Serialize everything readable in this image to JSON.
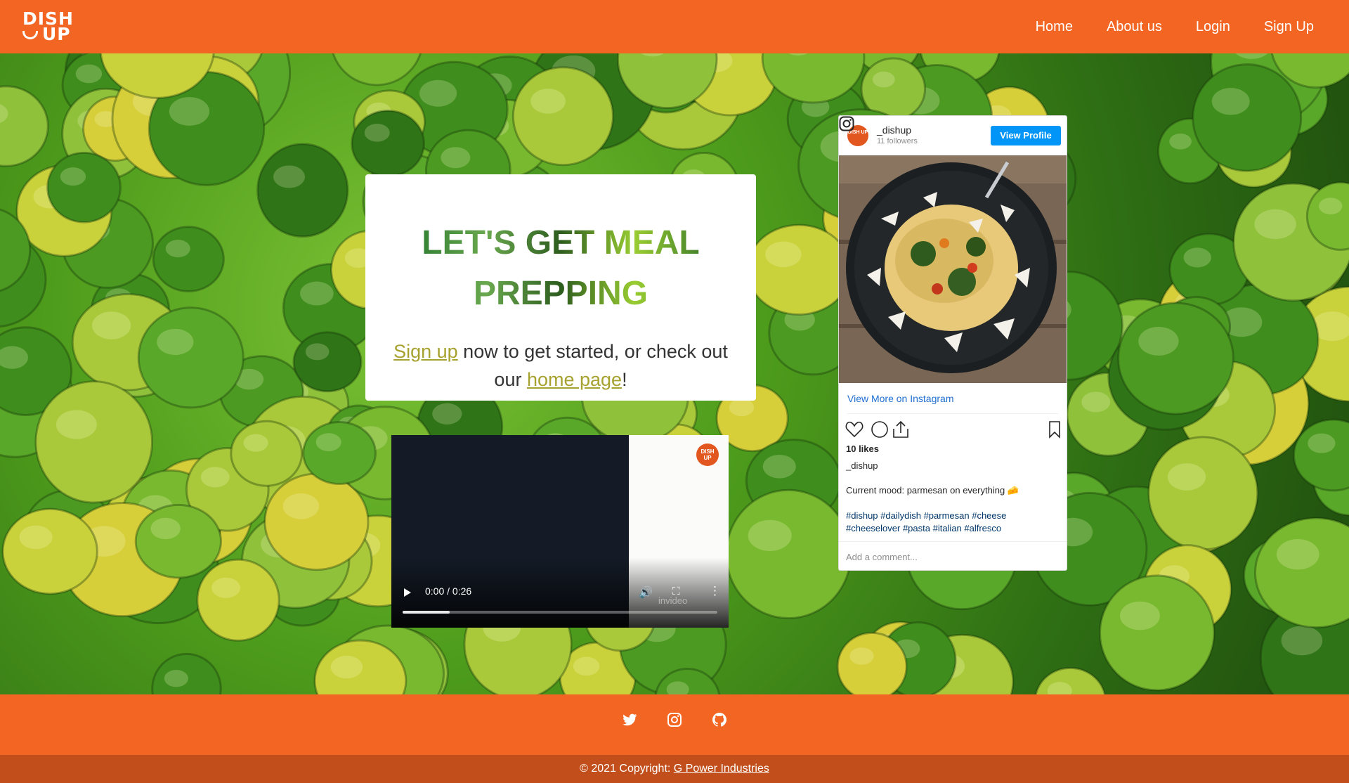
{
  "brand": {
    "logo_line1": "DISH",
    "logo_line2": "UP",
    "color": "#f26522"
  },
  "nav": {
    "links": [
      "Home",
      "About us",
      "Login",
      "Sign Up"
    ]
  },
  "hero": {
    "title": "LET'S GET MEAL PREPPING",
    "signup_link": "Sign up",
    "text_middle": " now to get started, or check out our ",
    "home_link": "home page",
    "text_end": "!"
  },
  "video": {
    "time": "0:00 / 0:26",
    "badge_text": "DISH UP",
    "watermark": "invideo",
    "progress": 0.15,
    "icons": [
      "play-icon",
      "volume-icon",
      "fullscreen-icon",
      "more-options-icon"
    ]
  },
  "instagram": {
    "avatar_text": "DISH UP",
    "username": "_dishup",
    "followers": "11 followers",
    "view_profile": "View Profile",
    "view_more": "View More on Instagram",
    "likes": "10 likes",
    "owner": "_dishup",
    "caption": "Current mood: parmesan on everything 🧀",
    "hashtags": "#dishup #dailydish #parmesan #cheese #cheeselover #pasta #italian #alfresco",
    "comment_placeholder": "Add a comment...",
    "accent": "#0095f6"
  },
  "footer": {
    "social_icons": [
      "twitter-icon",
      "instagram-icon",
      "github-icon"
    ],
    "copyright_prefix": "© 2021 Copyright: ",
    "copyright_link": "G Power Industries"
  }
}
